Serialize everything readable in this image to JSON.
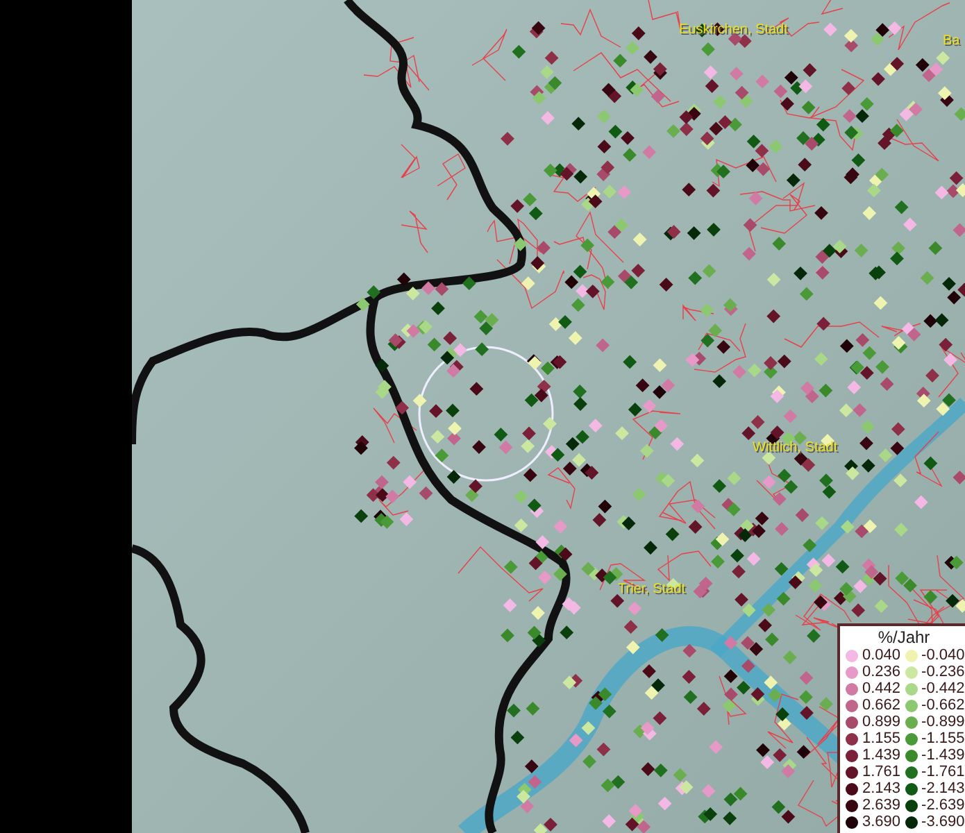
{
  "map": {
    "place_labels": [
      {
        "text": "Euskirchen, Stadt"
      },
      {
        "text": "Ba"
      },
      {
        "text": "Wittlich, Stadt"
      },
      {
        "text": "Trier, Stadt"
      }
    ]
  },
  "legend": {
    "title": "%/Jahr",
    "positive": [
      {
        "label": "0.040",
        "color": "#f4b8e4"
      },
      {
        "label": "0.236",
        "color": "#e79ac8"
      },
      {
        "label": "0.442",
        "color": "#d07aa4"
      },
      {
        "label": "0.662",
        "color": "#c0668c"
      },
      {
        "label": "0.899",
        "color": "#a84a6a"
      },
      {
        "label": "1.155",
        "color": "#8e3048"
      },
      {
        "label": "1.439",
        "color": "#7a2038"
      },
      {
        "label": "1.761",
        "color": "#641428"
      },
      {
        "label": "2.143",
        "color": "#4a0a18"
      },
      {
        "label": "2.639",
        "color": "#380610"
      },
      {
        "label": "3.690",
        "color": "#200208"
      }
    ],
    "negative": [
      {
        "label": "-0.040",
        "color": "#eef4b0"
      },
      {
        "label": "-0.236",
        "color": "#cce8a0"
      },
      {
        "label": "-0.442",
        "color": "#a8d888"
      },
      {
        "label": "-0.662",
        "color": "#8cc870"
      },
      {
        "label": "-0.899",
        "color": "#6aae50"
      },
      {
        "label": "-1.155",
        "color": "#4a9a38"
      },
      {
        "label": "-1.439",
        "color": "#3a8a2c"
      },
      {
        "label": "-1.761",
        "color": "#207020"
      },
      {
        "label": "-2.143",
        "color": "#105a14"
      },
      {
        "label": "-2.639",
        "color": "#0a400c"
      },
      {
        "label": "-3.690",
        "color": "#052808"
      }
    ]
  }
}
